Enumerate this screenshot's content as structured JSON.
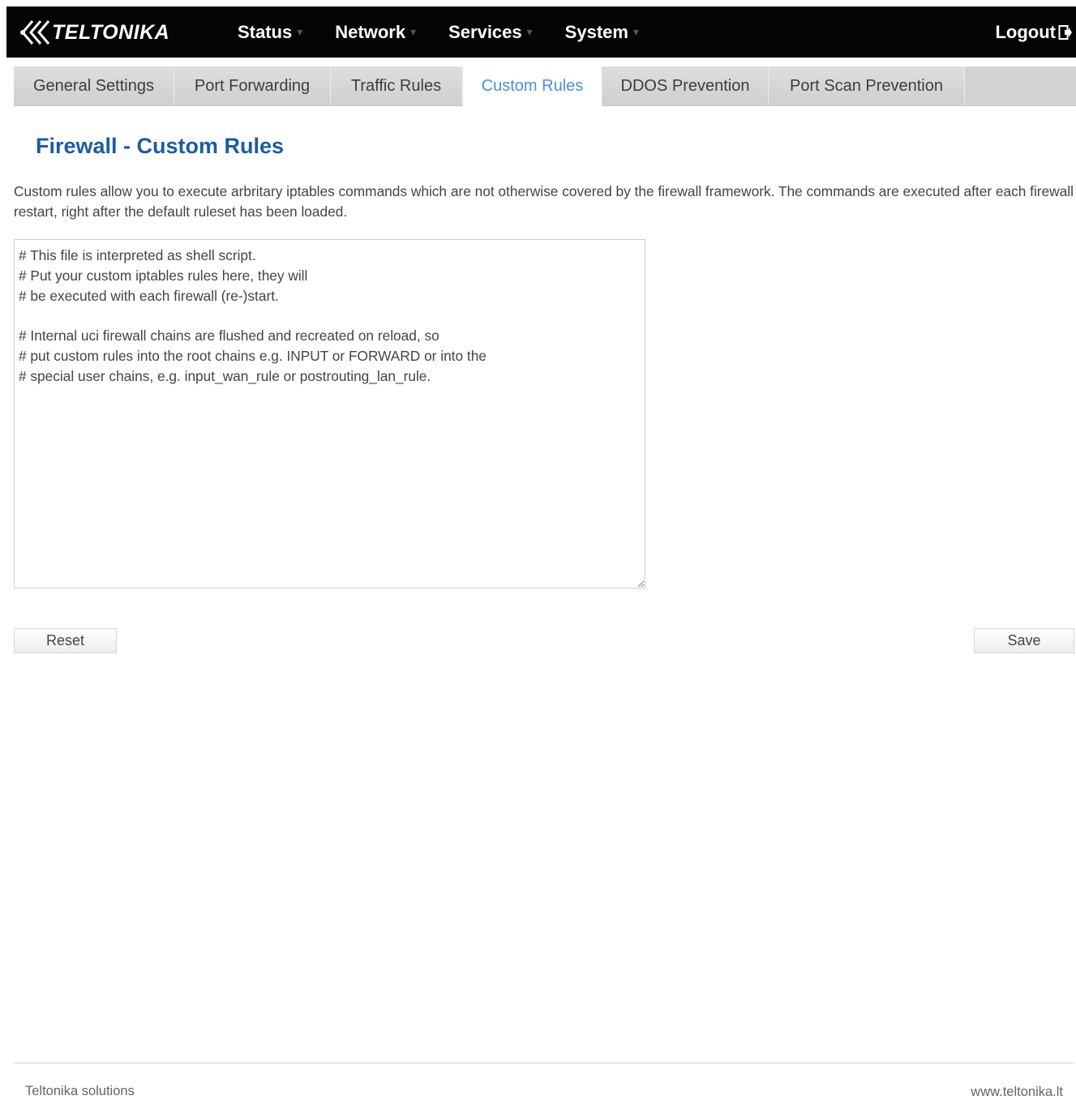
{
  "header": {
    "brand": "TELTONIKA",
    "nav": [
      {
        "label": "Status"
      },
      {
        "label": "Network"
      },
      {
        "label": "Services"
      },
      {
        "label": "System"
      }
    ],
    "logout_label": "Logout"
  },
  "tabs": [
    {
      "label": "General Settings",
      "active": false
    },
    {
      "label": "Port Forwarding",
      "active": false
    },
    {
      "label": "Traffic Rules",
      "active": false
    },
    {
      "label": "Custom Rules",
      "active": true
    },
    {
      "label": "DDOS Prevention",
      "active": false
    },
    {
      "label": "Port Scan Prevention",
      "active": false
    }
  ],
  "page": {
    "title": "Firewall - Custom Rules",
    "description": "Custom rules allow you to execute arbritary iptables commands which are not otherwise covered by the firewall framework. The commands are executed after each firewall restart, right after the default ruleset has been loaded.",
    "editor_content": "# This file is interpreted as shell script.\n# Put your custom iptables rules here, they will\n# be executed with each firewall (re-)start.\n\n# Internal uci firewall chains are flushed and recreated on reload, so\n# put custom rules into the root chains e.g. INPUT or FORWARD or into the\n# special user chains, e.g. input_wan_rule or postrouting_lan_rule."
  },
  "actions": {
    "reset_label": "Reset",
    "save_label": "Save"
  },
  "footer": {
    "left": "Teltonika solutions",
    "right": "www.teltonika.lt"
  },
  "colors": {
    "topbar": "#050505",
    "title": "#1e5aa6",
    "active_tab_text": "#4a90d9"
  }
}
